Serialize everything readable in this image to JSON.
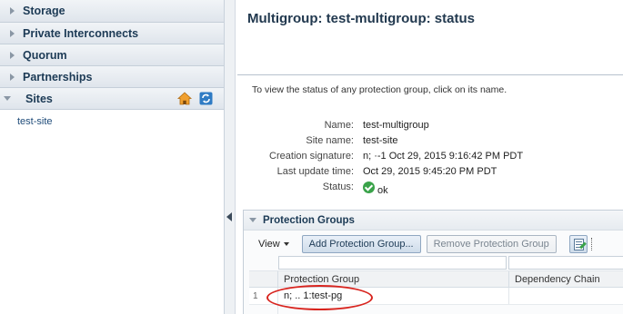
{
  "nav": {
    "items": [
      {
        "label": "Storage"
      },
      {
        "label": "Private Interconnects"
      },
      {
        "label": "Quorum"
      },
      {
        "label": "Partnerships"
      },
      {
        "label": "Sites"
      }
    ],
    "sites_list": [
      "test-site"
    ],
    "tool_icons": [
      "home-icon",
      "refresh-icon"
    ]
  },
  "main": {
    "title": "Multigroup: test-multigroup: status",
    "hint": "To view the status of any protection group, click on its name.",
    "properties": {
      "name_label": "Name:",
      "name_value": "test-multigroup",
      "site_label": "Site name:",
      "site_value": "test-site",
      "creation_label": "Creation signature:",
      "creation_value": "n; ·-1 Oct 29, 2015 9:16:42 PM PDT",
      "update_label": "Last update time:",
      "update_value": "Oct 29, 2015 9:45:20 PM PDT",
      "status_label": "Status:",
      "status_value": "ok"
    },
    "protection_groups": {
      "title": "Protection Groups",
      "view_label": "View",
      "add_button": "Add Protection Group...",
      "remove_button": "Remove Protection Group",
      "columns": [
        "Protection Group",
        "Dependency Chain"
      ],
      "rows": [
        {
          "index": "1",
          "group": "n; .. 1:test-pg",
          "chain": ""
        }
      ]
    }
  },
  "colors": {
    "accent": "#1c3a55",
    "ok": "#3aa34a",
    "highlight": "#d8241e"
  }
}
